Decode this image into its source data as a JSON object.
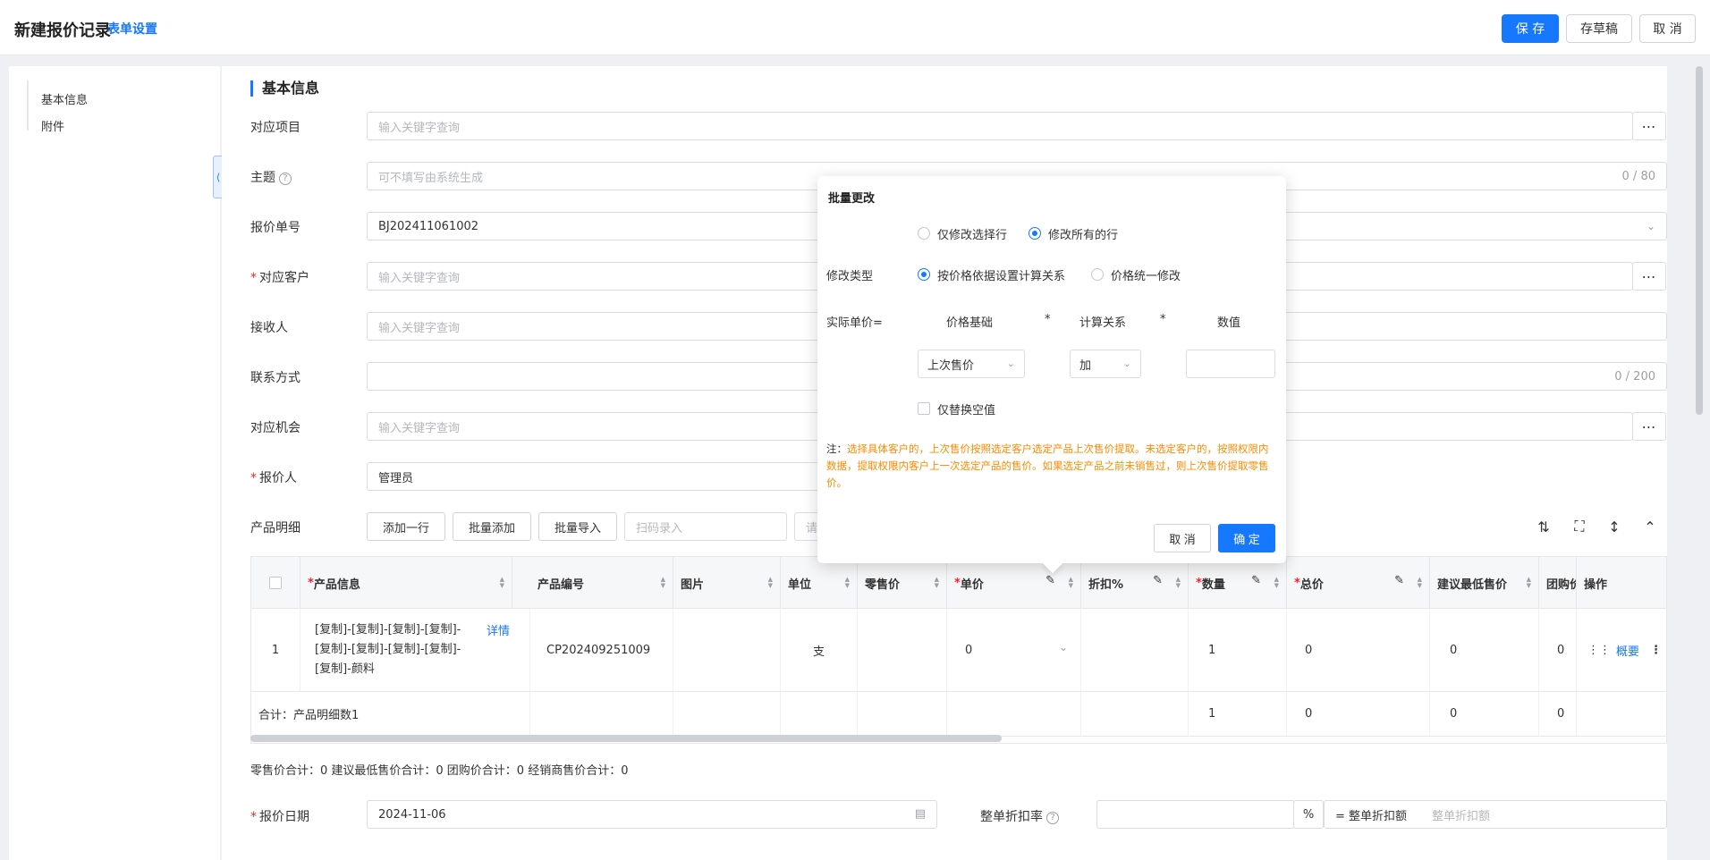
{
  "header": {
    "title": "新建报价记录",
    "form_settings": "表单设置",
    "save": "保 存",
    "draft": "存草稿",
    "cancel": "取 消"
  },
  "sidebar": {
    "items": [
      {
        "label": "基本信息"
      },
      {
        "label": "附件"
      }
    ]
  },
  "section": {
    "title": "基本信息"
  },
  "fields": {
    "project": {
      "label": "对应项目",
      "placeholder": "输入关键字查询"
    },
    "subject": {
      "label": "主题",
      "placeholder": "可不填写由系统生成",
      "count": "0 / 80"
    },
    "quote_no": {
      "label": "报价单号",
      "value": "BJ202411061002"
    },
    "customer": {
      "label": "对应客户",
      "placeholder": "输入关键字查询",
      "required": "*"
    },
    "receiver": {
      "label": "接收人",
      "placeholder": "输入关键字查询"
    },
    "contact": {
      "label": "联系方式",
      "count": "0 / 200"
    },
    "opportunity": {
      "label": "对应机会",
      "placeholder": "输入关键字查询"
    },
    "quoter": {
      "label": "报价人",
      "value": "管理员",
      "required": "*"
    },
    "quote_date": {
      "label": "报价日期",
      "value": "2024-11-06",
      "required": "*"
    },
    "discount_rate": {
      "label": "整单折扣率",
      "unit": "%"
    },
    "discount_amount": {
      "label": "= 整单折扣额",
      "placeholder": "整单折扣额"
    }
  },
  "products": {
    "label": "产品明细",
    "buttons": {
      "add_row": "添加一行",
      "batch_add": "批量添加",
      "batch_import": "批量导入",
      "scan_placeholder": "扫码录入",
      "partial": "请"
    },
    "columns": {
      "info": "产品信息",
      "code": "产品编号",
      "image": "图片",
      "unit": "单位",
      "retail": "零售价",
      "price": "单价",
      "discount": "折扣%",
      "qty": "数量",
      "total": "总价",
      "min_price": "建议最低售价",
      "group": "团购价",
      "ops": "操作",
      "required_mark": "*"
    },
    "rows": [
      {
        "index": "1",
        "info": "[复制]-[复制]-[复制]-[复制]-[复制]-[复制]-[复制]-[复制]-[复制]-颜料",
        "detail": "详情",
        "code": "CP202409251009",
        "unit": "支",
        "price": "0",
        "qty": "1",
        "total": "0",
        "min_price": "0",
        "group": "0",
        "overview": "概要"
      }
    ],
    "summary": {
      "label": "合计：产品明细数1",
      "qty": "1",
      "total": "0",
      "min_price": "0",
      "group": "0"
    },
    "totals_text": "零售价合计：0  建议最低售价合计：0  团购价合计：0  经销商售价合计：0"
  },
  "modal": {
    "title": "批量更改",
    "scope_options": [
      "仅修改选择行",
      "修改所有的行"
    ],
    "scope_selected": 1,
    "type_label": "修改类型",
    "type_options": [
      "按价格依据设置计算关系",
      "价格统一修改"
    ],
    "type_selected": 0,
    "formula_label": "实际单价=",
    "col_base": "价格基础",
    "times": "*",
    "col_relation": "计算关系",
    "col_value": "数值",
    "base_value": "上次售价",
    "relation_value": "加",
    "replace_empty": "仅替换空值",
    "note_lead": "注：",
    "note_text": "选择具体客户的，上次售价按照选定客户选定产品上次售价提取。未选定客户的，按照权限内数据，提取权限内客户上一次选定产品的售价。如果选定产品之前未销售过，则上次售价提取零售价。",
    "cancel": "取 消",
    "confirm": "确 定"
  },
  "colors": {
    "accent": "#1677ff",
    "required": "#f5222d",
    "note": "#ff8a00"
  }
}
